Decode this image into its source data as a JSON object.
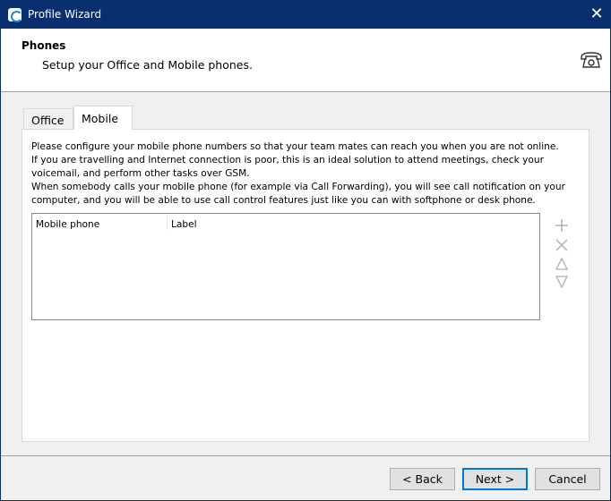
{
  "window": {
    "title": "Profile Wizard",
    "close_icon": "close-icon"
  },
  "header": {
    "title": "Phones",
    "subtitle": "Setup your Office and Mobile phones.",
    "icon": "telephone-icon"
  },
  "tabs": [
    {
      "label": "Office",
      "selected": false
    },
    {
      "label": "Mobile",
      "selected": true
    }
  ],
  "mobile": {
    "description": [
      "Please configure your mobile phone numbers so that your team mates can reach you when you are not online.",
      "If you are travelling and Internet connection is poor, this is an ideal solution to attend meetings, check your voicemail, and perform other tasks over GSM.",
      "When somebody calls your mobile phone (for example via Call Forwarding), you will see call notification on your computer, and you will be able to use call control features just like you can with softphone or desk phone."
    ],
    "table": {
      "columns": [
        "Mobile phone",
        "Label"
      ],
      "rows": []
    },
    "actions": [
      "add-icon",
      "remove-icon",
      "move-up-icon",
      "move-down-icon"
    ]
  },
  "footer": {
    "back": "< Back",
    "next": "Next >",
    "cancel": "Cancel"
  },
  "colors": {
    "titlebar": "#0a2f6e",
    "focus": "#0078d7"
  }
}
